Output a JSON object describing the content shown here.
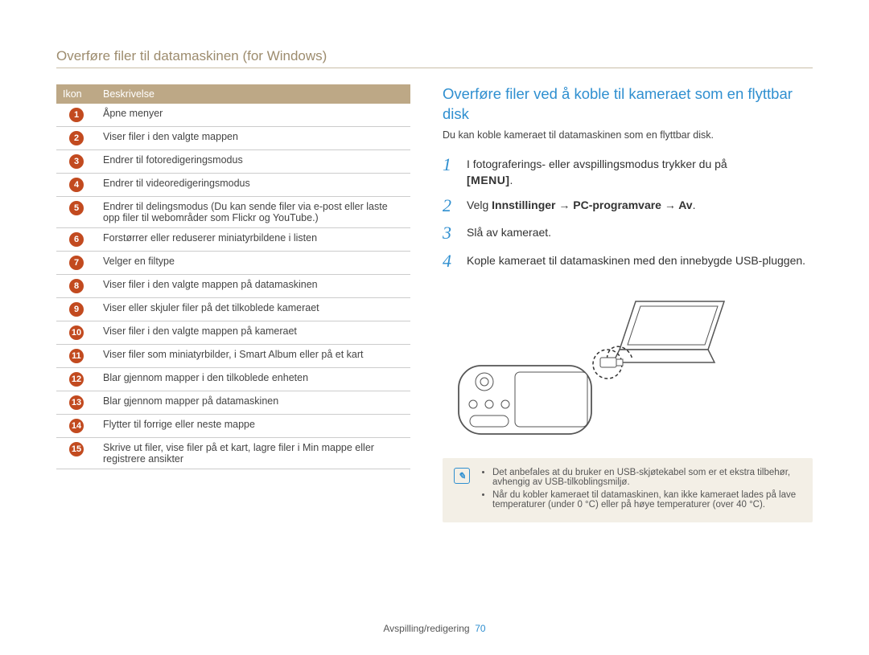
{
  "header": "Overføre filer til datamaskinen (for Windows)",
  "table": {
    "col_icon": "Ikon",
    "col_desc": "Beskrivelse",
    "rows": [
      {
        "n": "1",
        "desc": "Åpne menyer"
      },
      {
        "n": "2",
        "desc": "Viser filer i den valgte mappen"
      },
      {
        "n": "3",
        "desc": "Endrer til fotoredigeringsmodus"
      },
      {
        "n": "4",
        "desc": "Endrer til videoredigeringsmodus"
      },
      {
        "n": "5",
        "desc": "Endrer til delingsmodus (Du kan sende filer via e-post eller laste opp filer til webområder som Flickr og YouTube.)"
      },
      {
        "n": "6",
        "desc": "Forstørrer eller reduserer miniatyrbildene i listen"
      },
      {
        "n": "7",
        "desc": "Velger en filtype"
      },
      {
        "n": "8",
        "desc": "Viser filer i den valgte mappen på datamaskinen"
      },
      {
        "n": "9",
        "desc": "Viser eller skjuler filer på det tilkoblede kameraet"
      },
      {
        "n": "10",
        "desc": "Viser filer i den valgte mappen på kameraet"
      },
      {
        "n": "11",
        "desc": "Viser filer som miniatyrbilder, i Smart Album eller på et kart"
      },
      {
        "n": "12",
        "desc": "Blar gjennom mapper i den tilkoblede enheten"
      },
      {
        "n": "13",
        "desc": "Blar gjennom mapper på datamaskinen"
      },
      {
        "n": "14",
        "desc": "Flytter til forrige eller neste mappe"
      },
      {
        "n": "15",
        "desc": "Skrive ut filer, vise filer på et kart, lagre filer i Min mappe eller registrere ansikter"
      }
    ]
  },
  "section": {
    "title": "Overføre filer ved å koble til kameraet som en flyttbar disk",
    "intro": "Du kan koble kameraet til datamaskinen som en flyttbar disk."
  },
  "steps": [
    {
      "n": "1",
      "pre": "I fotograferings- eller avspillingsmodus trykker du på ",
      "key": "[MENU]",
      "post": "."
    },
    {
      "n": "2",
      "pre": "Velg ",
      "bold": "Innstillinger → PC-programvare → Av",
      "post": "."
    },
    {
      "n": "3",
      "text": "Slå av kameraet."
    },
    {
      "n": "4",
      "text": "Kople kameraet til datamaskinen med den innebygde USB-pluggen."
    }
  ],
  "notes": [
    "Det anbefales at du bruker en USB-skjøtekabel som er et ekstra tilbehør, avhengig av USB-tilkoblingsmiljø.",
    "Når du kobler kameraet til datamaskinen, kan ikke kameraet lades på lave temperaturer (under 0 °C) eller på høye temperaturer (over 40 °C)."
  ],
  "footer": {
    "section": "Avspilling/redigering",
    "page": "70"
  }
}
